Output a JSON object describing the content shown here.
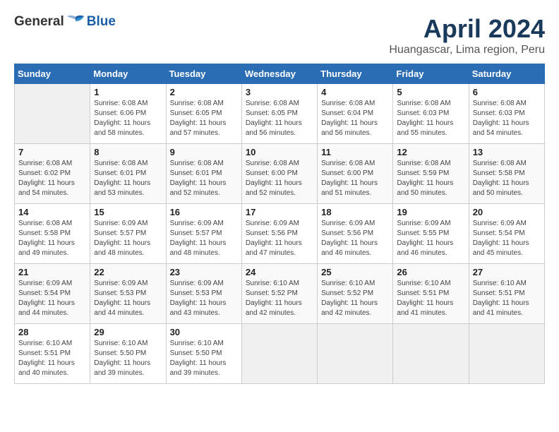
{
  "logo": {
    "general": "General",
    "blue": "Blue"
  },
  "title": "April 2024",
  "subtitle": "Huangascar, Lima region, Peru",
  "headers": [
    "Sunday",
    "Monday",
    "Tuesday",
    "Wednesday",
    "Thursday",
    "Friday",
    "Saturday"
  ],
  "weeks": [
    [
      {
        "day": "",
        "info": ""
      },
      {
        "day": "1",
        "info": "Sunrise: 6:08 AM\nSunset: 6:06 PM\nDaylight: 11 hours\nand 58 minutes."
      },
      {
        "day": "2",
        "info": "Sunrise: 6:08 AM\nSunset: 6:05 PM\nDaylight: 11 hours\nand 57 minutes."
      },
      {
        "day": "3",
        "info": "Sunrise: 6:08 AM\nSunset: 6:05 PM\nDaylight: 11 hours\nand 56 minutes."
      },
      {
        "day": "4",
        "info": "Sunrise: 6:08 AM\nSunset: 6:04 PM\nDaylight: 11 hours\nand 56 minutes."
      },
      {
        "day": "5",
        "info": "Sunrise: 6:08 AM\nSunset: 6:03 PM\nDaylight: 11 hours\nand 55 minutes."
      },
      {
        "day": "6",
        "info": "Sunrise: 6:08 AM\nSunset: 6:03 PM\nDaylight: 11 hours\nand 54 minutes."
      }
    ],
    [
      {
        "day": "7",
        "info": "Sunrise: 6:08 AM\nSunset: 6:02 PM\nDaylight: 11 hours\nand 54 minutes."
      },
      {
        "day": "8",
        "info": "Sunrise: 6:08 AM\nSunset: 6:01 PM\nDaylight: 11 hours\nand 53 minutes."
      },
      {
        "day": "9",
        "info": "Sunrise: 6:08 AM\nSunset: 6:01 PM\nDaylight: 11 hours\nand 52 minutes."
      },
      {
        "day": "10",
        "info": "Sunrise: 6:08 AM\nSunset: 6:00 PM\nDaylight: 11 hours\nand 52 minutes."
      },
      {
        "day": "11",
        "info": "Sunrise: 6:08 AM\nSunset: 6:00 PM\nDaylight: 11 hours\nand 51 minutes."
      },
      {
        "day": "12",
        "info": "Sunrise: 6:08 AM\nSunset: 5:59 PM\nDaylight: 11 hours\nand 50 minutes."
      },
      {
        "day": "13",
        "info": "Sunrise: 6:08 AM\nSunset: 5:58 PM\nDaylight: 11 hours\nand 50 minutes."
      }
    ],
    [
      {
        "day": "14",
        "info": "Sunrise: 6:08 AM\nSunset: 5:58 PM\nDaylight: 11 hours\nand 49 minutes."
      },
      {
        "day": "15",
        "info": "Sunrise: 6:09 AM\nSunset: 5:57 PM\nDaylight: 11 hours\nand 48 minutes."
      },
      {
        "day": "16",
        "info": "Sunrise: 6:09 AM\nSunset: 5:57 PM\nDaylight: 11 hours\nand 48 minutes."
      },
      {
        "day": "17",
        "info": "Sunrise: 6:09 AM\nSunset: 5:56 PM\nDaylight: 11 hours\nand 47 minutes."
      },
      {
        "day": "18",
        "info": "Sunrise: 6:09 AM\nSunset: 5:56 PM\nDaylight: 11 hours\nand 46 minutes."
      },
      {
        "day": "19",
        "info": "Sunrise: 6:09 AM\nSunset: 5:55 PM\nDaylight: 11 hours\nand 46 minutes."
      },
      {
        "day": "20",
        "info": "Sunrise: 6:09 AM\nSunset: 5:54 PM\nDaylight: 11 hours\nand 45 minutes."
      }
    ],
    [
      {
        "day": "21",
        "info": "Sunrise: 6:09 AM\nSunset: 5:54 PM\nDaylight: 11 hours\nand 44 minutes."
      },
      {
        "day": "22",
        "info": "Sunrise: 6:09 AM\nSunset: 5:53 PM\nDaylight: 11 hours\nand 44 minutes."
      },
      {
        "day": "23",
        "info": "Sunrise: 6:09 AM\nSunset: 5:53 PM\nDaylight: 11 hours\nand 43 minutes."
      },
      {
        "day": "24",
        "info": "Sunrise: 6:10 AM\nSunset: 5:52 PM\nDaylight: 11 hours\nand 42 minutes."
      },
      {
        "day": "25",
        "info": "Sunrise: 6:10 AM\nSunset: 5:52 PM\nDaylight: 11 hours\nand 42 minutes."
      },
      {
        "day": "26",
        "info": "Sunrise: 6:10 AM\nSunset: 5:51 PM\nDaylight: 11 hours\nand 41 minutes."
      },
      {
        "day": "27",
        "info": "Sunrise: 6:10 AM\nSunset: 5:51 PM\nDaylight: 11 hours\nand 41 minutes."
      }
    ],
    [
      {
        "day": "28",
        "info": "Sunrise: 6:10 AM\nSunset: 5:51 PM\nDaylight: 11 hours\nand 40 minutes."
      },
      {
        "day": "29",
        "info": "Sunrise: 6:10 AM\nSunset: 5:50 PM\nDaylight: 11 hours\nand 39 minutes."
      },
      {
        "day": "30",
        "info": "Sunrise: 6:10 AM\nSunset: 5:50 PM\nDaylight: 11 hours\nand 39 minutes."
      },
      {
        "day": "",
        "info": ""
      },
      {
        "day": "",
        "info": ""
      },
      {
        "day": "",
        "info": ""
      },
      {
        "day": "",
        "info": ""
      }
    ]
  ]
}
